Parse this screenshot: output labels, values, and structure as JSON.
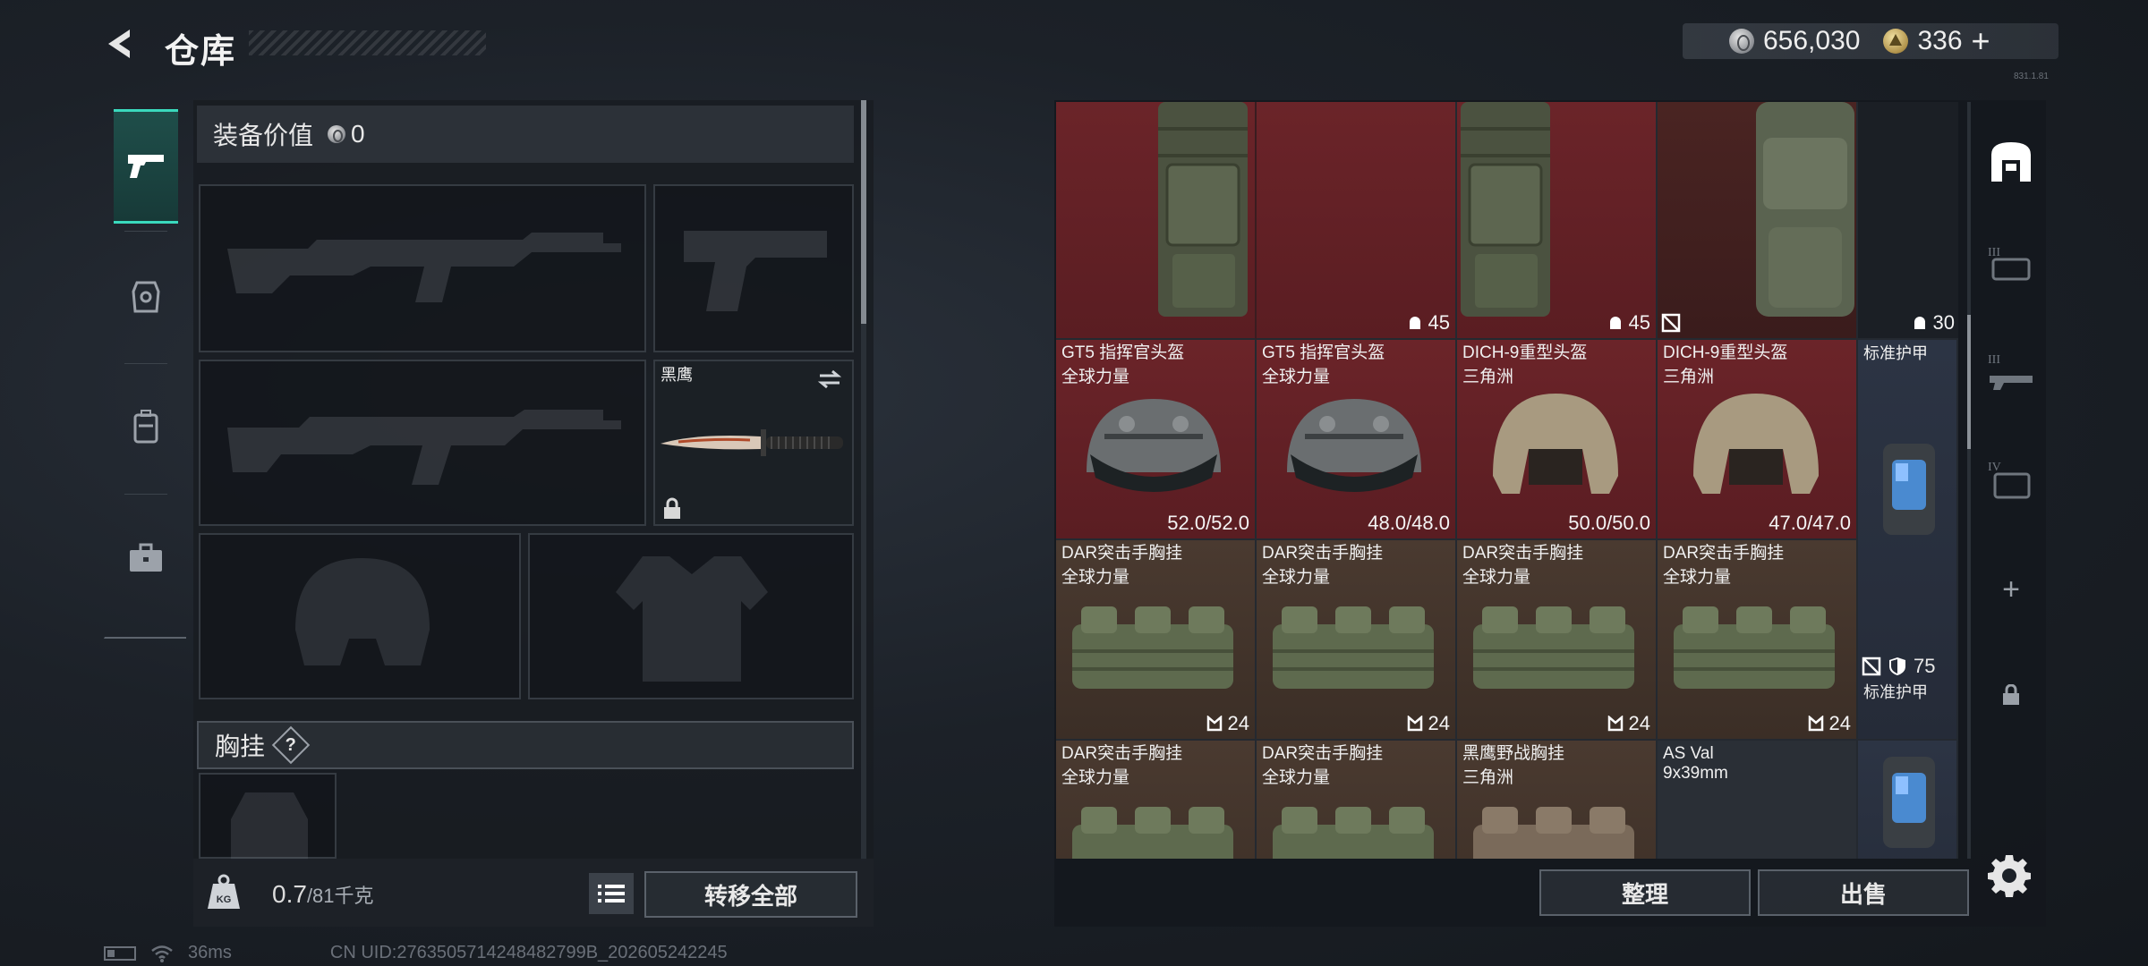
{
  "header": {
    "title": "仓库",
    "currency_silver": "656,030",
    "currency_gold": "336",
    "plus": "+",
    "build": "831.1.81"
  },
  "loadout": {
    "value_label": "装备价值",
    "value_amount": "0",
    "melee_name": "黑鹰",
    "vest_label": "胸挂",
    "vest_help": "?"
  },
  "weight": {
    "current": "0.7",
    "max": "/81千克",
    "kg_label": "KG"
  },
  "buttons": {
    "transfer_all": "转移全部",
    "organize": "整理",
    "sell": "出售"
  },
  "storage": {
    "row1": [
      {
        "value": "45",
        "icon": "durability-icon"
      },
      {
        "value": "45",
        "icon": "durability-icon"
      },
      {
        "value": "30",
        "icon": "durability-icon"
      }
    ],
    "helmets": [
      {
        "name": "GT5 指挥官头盔",
        "sub": "全球力量",
        "durability": "52.0/52.0"
      },
      {
        "name": "GT5 指挥官头盔",
        "sub": "全球力量",
        "durability": "48.0/48.0"
      },
      {
        "name": "DICH-9重型头盔",
        "sub": "三角洲",
        "durability": "50.0/50.0"
      },
      {
        "name": "DICH-9重型头盔",
        "sub": "三角洲",
        "durability": "47.0/47.0"
      }
    ],
    "armor_label": "标准护甲",
    "armor_value": "75",
    "armor_label2": "标准护甲",
    "vests": [
      {
        "name": "DAR突击手胸挂",
        "sub": "全球力量",
        "capacity": "24"
      },
      {
        "name": "DAR突击手胸挂",
        "sub": "全球力量",
        "capacity": "24"
      },
      {
        "name": "DAR突击手胸挂",
        "sub": "全球力量",
        "capacity": "24"
      },
      {
        "name": "DAR突击手胸挂",
        "sub": "全球力量",
        "capacity": "24"
      }
    ],
    "row4": [
      {
        "name": "DAR突击手胸挂",
        "sub": "全球力量"
      },
      {
        "name": "DAR突击手胸挂",
        "sub": "全球力量"
      },
      {
        "name": "黑鹰野战胸挂",
        "sub": "三角洲"
      },
      {
        "name": "AS Val",
        "sub": "9x39mm"
      }
    ]
  },
  "right_tabs": {
    "tier3": "III",
    "tier3b": "III",
    "tier4": "IV",
    "add": "+"
  },
  "status": {
    "ping": "36ms",
    "uid": "CN UID:2763505714248482799B_202605242245"
  },
  "colors": {
    "accent": "#3ad9bd",
    "cell_red": "#6b2429",
    "cell_green": "#4a3a30",
    "cell_blue": "#2c3444"
  }
}
